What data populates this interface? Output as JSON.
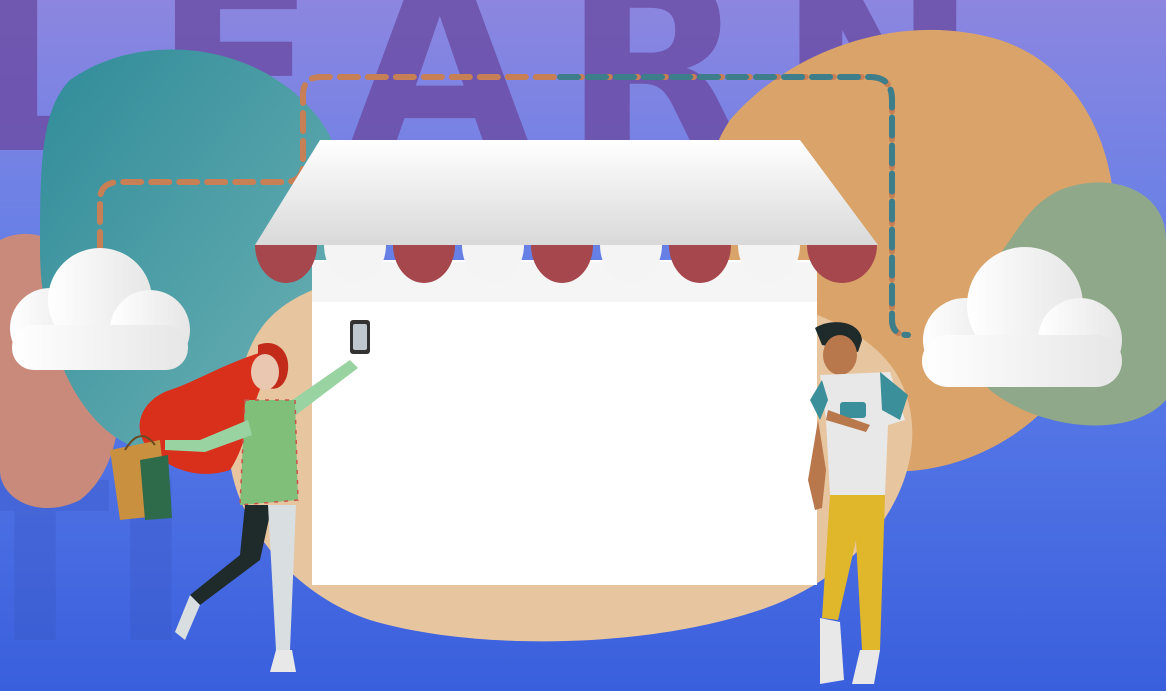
{
  "scene": {
    "background_word": "LEARN",
    "colors": {
      "sky_top": "#8a7fd6",
      "sky_bottom": "#3d63e0",
      "letters": "#6c4fa8",
      "teal_blob": "#3b93a1",
      "tan_blob": "#d9a36a",
      "sand_blob": "#e7c59f",
      "sage_blob": "#8fa88a",
      "rose_blob": "#c98a7c",
      "awning_red": "#a6474d",
      "awning_white": "#f2f2f2",
      "store_white": "#ffffff",
      "cloud": "#ffffff",
      "dash_orange": "#c77f55",
      "dash_teal": "#3e7d8a",
      "hair": "#d9301c",
      "bag": "#c8903f",
      "shirt": "#e8e8e8",
      "pants": "#e0b62a",
      "skin": "#e9c7b0",
      "skin_dark": "#b9784b"
    },
    "elements": [
      "storefront",
      "awning",
      "cloud-left",
      "cloud-right",
      "woman-with-shopping-bags",
      "man-with-smartphone",
      "smartphone-icon",
      "dashed-connection-line"
    ]
  }
}
